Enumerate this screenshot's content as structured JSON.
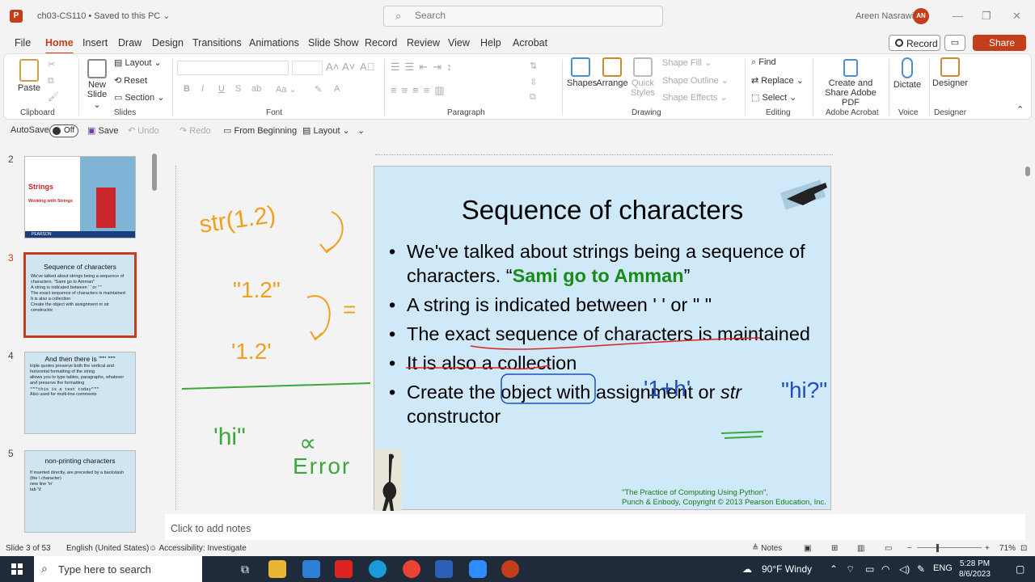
{
  "titlebar": {
    "doc_title": "ch03-CS110 • Saved to this PC ⌄",
    "search_placeholder": "Search",
    "user_name": "Areen Nasrawi",
    "user_initials": "AN"
  },
  "menu": {
    "tabs": [
      "File",
      "Home",
      "Insert",
      "Draw",
      "Design",
      "Transitions",
      "Animations",
      "Slide Show",
      "Record",
      "Review",
      "View",
      "Help",
      "Acrobat"
    ],
    "record_label": "Record",
    "share_label": "Share"
  },
  "ribbon": {
    "clipboard": {
      "paste": "Paste",
      "label": "Clipboard"
    },
    "slides": {
      "new_slide": "New Slide ⌄",
      "layout": "Layout ⌄",
      "reset": "Reset",
      "section": "Section ⌄",
      "label": "Slides"
    },
    "font": {
      "label": "Font",
      "b": "B",
      "i": "I",
      "u": "U",
      "s": "S",
      "ab": "ab",
      "aa": "Aa ⌄"
    },
    "paragraph": {
      "label": "Paragraph"
    },
    "drawing": {
      "shapes": "Shapes",
      "arrange": "Arrange",
      "quick_styles": "Quick Styles",
      "shape_fill": "Shape Fill ⌄",
      "shape_outline": "Shape Outline ⌄",
      "shape_effects": "Shape Effects ⌄",
      "label": "Drawing"
    },
    "editing": {
      "find": "Find",
      "replace": "Replace ⌄",
      "select": "Select ⌄",
      "label": "Editing"
    },
    "acrobat": {
      "create_share": "Create and Share Adobe PDF",
      "label": "Adobe Acrobat"
    },
    "voice": {
      "dictate": "Dictate",
      "label": "Voice"
    },
    "designer": {
      "designer": "Designer",
      "label": "Designer"
    }
  },
  "qat": {
    "autosave": "AutoSave",
    "autosave_state": "Off",
    "save": "Save",
    "undo": "Undo",
    "redo": "Redo",
    "from_beginning": "From Beginning",
    "layout": "Layout ⌄"
  },
  "thumbnails": [
    {
      "num": "2",
      "title": "Strings",
      "subtitle": "Working with Strings",
      "publisher": "PEARSON"
    },
    {
      "num": "3",
      "title": "Sequence of characters",
      "bullets": [
        "We've talked about strings being a sequence of characters. \"Sami go to Amman\"",
        "A string is indicated between ' ' or \" \"",
        "The exact sequence of characters is maintained",
        "It is also a collection",
        "Create the object with assignment or str constructor"
      ]
    },
    {
      "num": "4",
      "title": "And then there is \"\"\" \"\"\"",
      "bullets": [
        "triple quotes preserve both the vertical and horizontal formatting of the string",
        "allows you to type tables, paragraphs, whatever and preserve the formatting",
        "\"\"\"this is a test today\"\"\"",
        "Also used for multi-line comments"
      ]
    },
    {
      "num": "5",
      "title": "non-printing characters",
      "bullets": [
        "If inserted directly, are preceded by a backslash (the \\ character)",
        "new line '\\n'",
        "tab '\\t'"
      ]
    }
  ],
  "slide": {
    "title": "Sequence of characters",
    "b1_pre": "We've talked about strings being a sequence of characters. “",
    "b1_green": "Sami go to Amman",
    "b1_post": "”",
    "b2": "A string is indicated between  '   '   or \"   \"",
    "b3": "The exact sequence of characters is maintained",
    "b4_pre": "It is also a ",
    "b4_word": "collection",
    "b5_pre": "Create the object with assignment or ",
    "b5_italic": "str",
    "b5_post": " constructor",
    "credit_1": "\"The Practice of Computing Using Python\",",
    "credit_2": "Punch & Enbody, Copyright © 2013 Pearson Education, Inc."
  },
  "ink": {
    "str_call": "str(1.2)",
    "q1": "\"1.2\"",
    "q2": "'1.2'",
    "eq": "=",
    "hi": "'hi\"",
    "alpha": "∝",
    "error": "Error",
    "one_h": "'1+h'",
    "hi2": "\"hi?\""
  },
  "notes": {
    "placeholder": "Click to add notes"
  },
  "status": {
    "slide_pos": "Slide 3 of 53",
    "language": "English (United States)",
    "accessibility": "Accessibility: Investigate",
    "notes": "Notes",
    "zoom": "71%"
  },
  "taskbar": {
    "search": "Type here to search",
    "weather": "90°F  Windy",
    "lang": "ENG",
    "time": "5:28 PM",
    "date": "8/6/2023"
  }
}
